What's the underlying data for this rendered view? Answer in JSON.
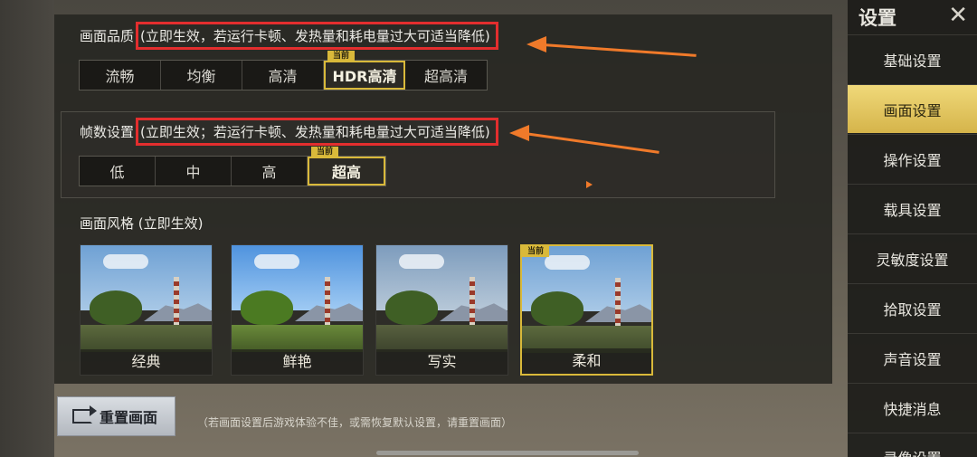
{
  "quality": {
    "title": "画面品质",
    "note": "(立即生效，若运行卡顿、发热量和耗电量过大可适当降低)",
    "options": [
      "流畅",
      "均衡",
      "高清",
      "HDR高清",
      "超高清"
    ],
    "selected": "HDR高清",
    "current_tag": "当前"
  },
  "fps": {
    "title": "帧数设置",
    "note": "(立即生效；若运行卡顿、发热量和耗电量过大可适当降低)",
    "options": [
      "低",
      "中",
      "高",
      "超高"
    ],
    "selected": "超高",
    "current_tag": "当前"
  },
  "style": {
    "title": "画面风格 (立即生效)",
    "options": [
      "经典",
      "鲜艳",
      "写实",
      "柔和"
    ],
    "selected": "柔和",
    "current_tag": "当前"
  },
  "reset": {
    "label": "重置画面",
    "hint": "（若画面设置后游戏体验不佳，或需恢复默认设置，请重置画面）"
  },
  "sidebar": {
    "title": "设置",
    "close": "✕",
    "items": [
      "基础设置",
      "画面设置",
      "操作设置",
      "载具设置",
      "灵敏度设置",
      "拾取设置",
      "声音设置",
      "快捷消息",
      "录像设置"
    ],
    "active": "画面设置"
  },
  "colors": {
    "accent": "#d9b93a",
    "highlight_box": "#e32e2e",
    "arrow": "#f07a2a"
  }
}
